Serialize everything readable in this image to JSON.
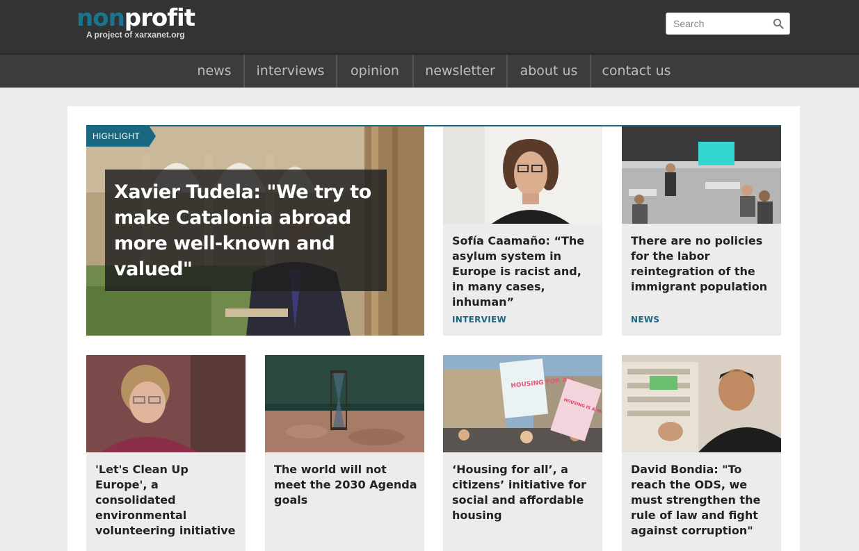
{
  "header": {
    "logo_non": "non",
    "logo_profit": "profit",
    "logo_sub": "A project of xarxanet.org",
    "search_placeholder": "Search"
  },
  "nav": {
    "items": [
      "news",
      "interviews",
      "opinion",
      "newsletter",
      "about us",
      "contact us"
    ]
  },
  "featured": {
    "tag": "HIGHLIGHT",
    "title": "Xavier Tudela: \"We try to make Catalonia abroad more well-known and valued\""
  },
  "cards": [
    {
      "title": "Sofía Caamaño: “The asylum system in Europe is racist and, in many cases, inhuman”",
      "category": "INTERVIEW"
    },
    {
      "title": "There are no policies for the labor reintegration of the immigrant population",
      "category": "NEWS"
    },
    {
      "title": "'Let's Clean Up Europe', a consolidated environmental volunteering initiative",
      "category": ""
    },
    {
      "title": "The world will not meet the 2030 Agenda goals",
      "category": ""
    },
    {
      "title": "‘Housing for all’, a citizens’ initiative for social and affordable housing",
      "category": ""
    },
    {
      "title": "David Bondia: \"To reach the ODS, we must strengthen the rule of law and fight against corruption\"",
      "category": ""
    }
  ],
  "sign_text": {
    "sign1": "HOUSING FOR ALL",
    "sign2": "HOUSING IS A HUMAN RIGHT"
  },
  "colors": {
    "accent": "#1a6782",
    "logo_blue": "#1a7590",
    "header_bg": "#333333",
    "nav_bg": "#3c3c3c",
    "page_bg": "#ececec"
  }
}
